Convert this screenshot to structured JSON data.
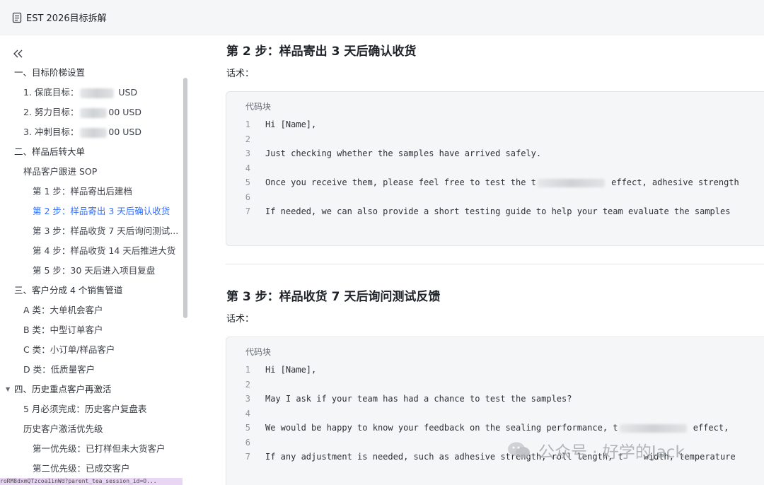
{
  "header": {
    "title": "EST 2026目标拆解"
  },
  "sidebar": {
    "toc": [
      {
        "text": "一、目标阶梯设置",
        "level": 1
      },
      {
        "text_prefix": "1. 保底目标：",
        "text_suffix": " USD",
        "level": 2,
        "blurred": true
      },
      {
        "text_prefix": "2. 努力目标：",
        "text_suffix": "00 USD",
        "level": 2,
        "blurred": true
      },
      {
        "text_prefix": "3. 冲刺目标：",
        "text_suffix": "00 USD",
        "level": 2,
        "blurred": true
      },
      {
        "text": "二、样品后转大单",
        "level": 1
      },
      {
        "text": "样品客户跟进 SOP",
        "level": 2
      },
      {
        "text": "第 1 步：样品寄出后建档",
        "level": 3
      },
      {
        "text": "第 2 步：样品寄出 3 天后确认收货",
        "level": 3,
        "active": true
      },
      {
        "text": "第 3 步：样品收货 7 天后询问测试...",
        "level": 3
      },
      {
        "text": "第 4 步：样品收货 14 天后推进大货",
        "level": 3
      },
      {
        "text": "第 5 步：30 天后进入项目复盘",
        "level": 3
      },
      {
        "text": "三、客户分成 4 个销售管道",
        "level": 1
      },
      {
        "text": "A 类：大单机会客户",
        "level": 2
      },
      {
        "text": "B 类：中型订单客户",
        "level": 2
      },
      {
        "text": "C 类：小订单/样品客户",
        "level": 2
      },
      {
        "text": "D 类：低质量客户",
        "level": 2
      },
      {
        "text": "四、历史重点客户再激活",
        "level": 1,
        "expanded": true
      },
      {
        "text": "5 月必须完成：历史客户复盘表",
        "level": 2
      },
      {
        "text": "历史客户激活优先级",
        "level": 2
      },
      {
        "text": "第一优先级：已打样但未大货客户",
        "level": 3
      },
      {
        "text": "第二优先级：已成交客户",
        "level": 3
      }
    ],
    "url_fragment": "roRM8dxmQTzcoa1inWd?parent_tea_session_id=O..."
  },
  "main": {
    "step2": {
      "heading": "第 2 步：样品寄出 3 天后确认收货",
      "label": "话术：",
      "code_caption": "代码块",
      "lines": [
        {
          "n": "1",
          "text": "Hi [Name],"
        },
        {
          "n": "2",
          "text": ""
        },
        {
          "n": "3",
          "text": "Just checking whether the samples have arrived safely."
        },
        {
          "n": "4",
          "text": ""
        },
        {
          "n": "5",
          "text_before": "Once you receive them, please feel free to test the t",
          "text_after": " effect, adhesive strength",
          "blurred": true
        },
        {
          "n": "6",
          "text": ""
        },
        {
          "n": "7",
          "text": "If needed, we can also provide a short testing guide to help your team evaluate the samples"
        }
      ]
    },
    "step3": {
      "heading": "第 3 步：样品收货 7 天后询问测试反馈",
      "label": "话术：",
      "code_caption": "代码块",
      "lines": [
        {
          "n": "1",
          "text": "Hi [Name],"
        },
        {
          "n": "2",
          "text": ""
        },
        {
          "n": "3",
          "text": "May I ask if your team has had a chance to test the samples?"
        },
        {
          "n": "4",
          "text": ""
        },
        {
          "n": "5",
          "text_before": "We would be happy to know your feedback on the sealing performance, t",
          "text_after": " effect,",
          "blurred": true
        },
        {
          "n": "6",
          "text": ""
        },
        {
          "n": "7",
          "text": "If any adjustment is needed, such as adhesive strength, roll length, t    width, temperature"
        }
      ]
    }
  },
  "watermark": {
    "text": "公众号 · 好学的Jack"
  }
}
